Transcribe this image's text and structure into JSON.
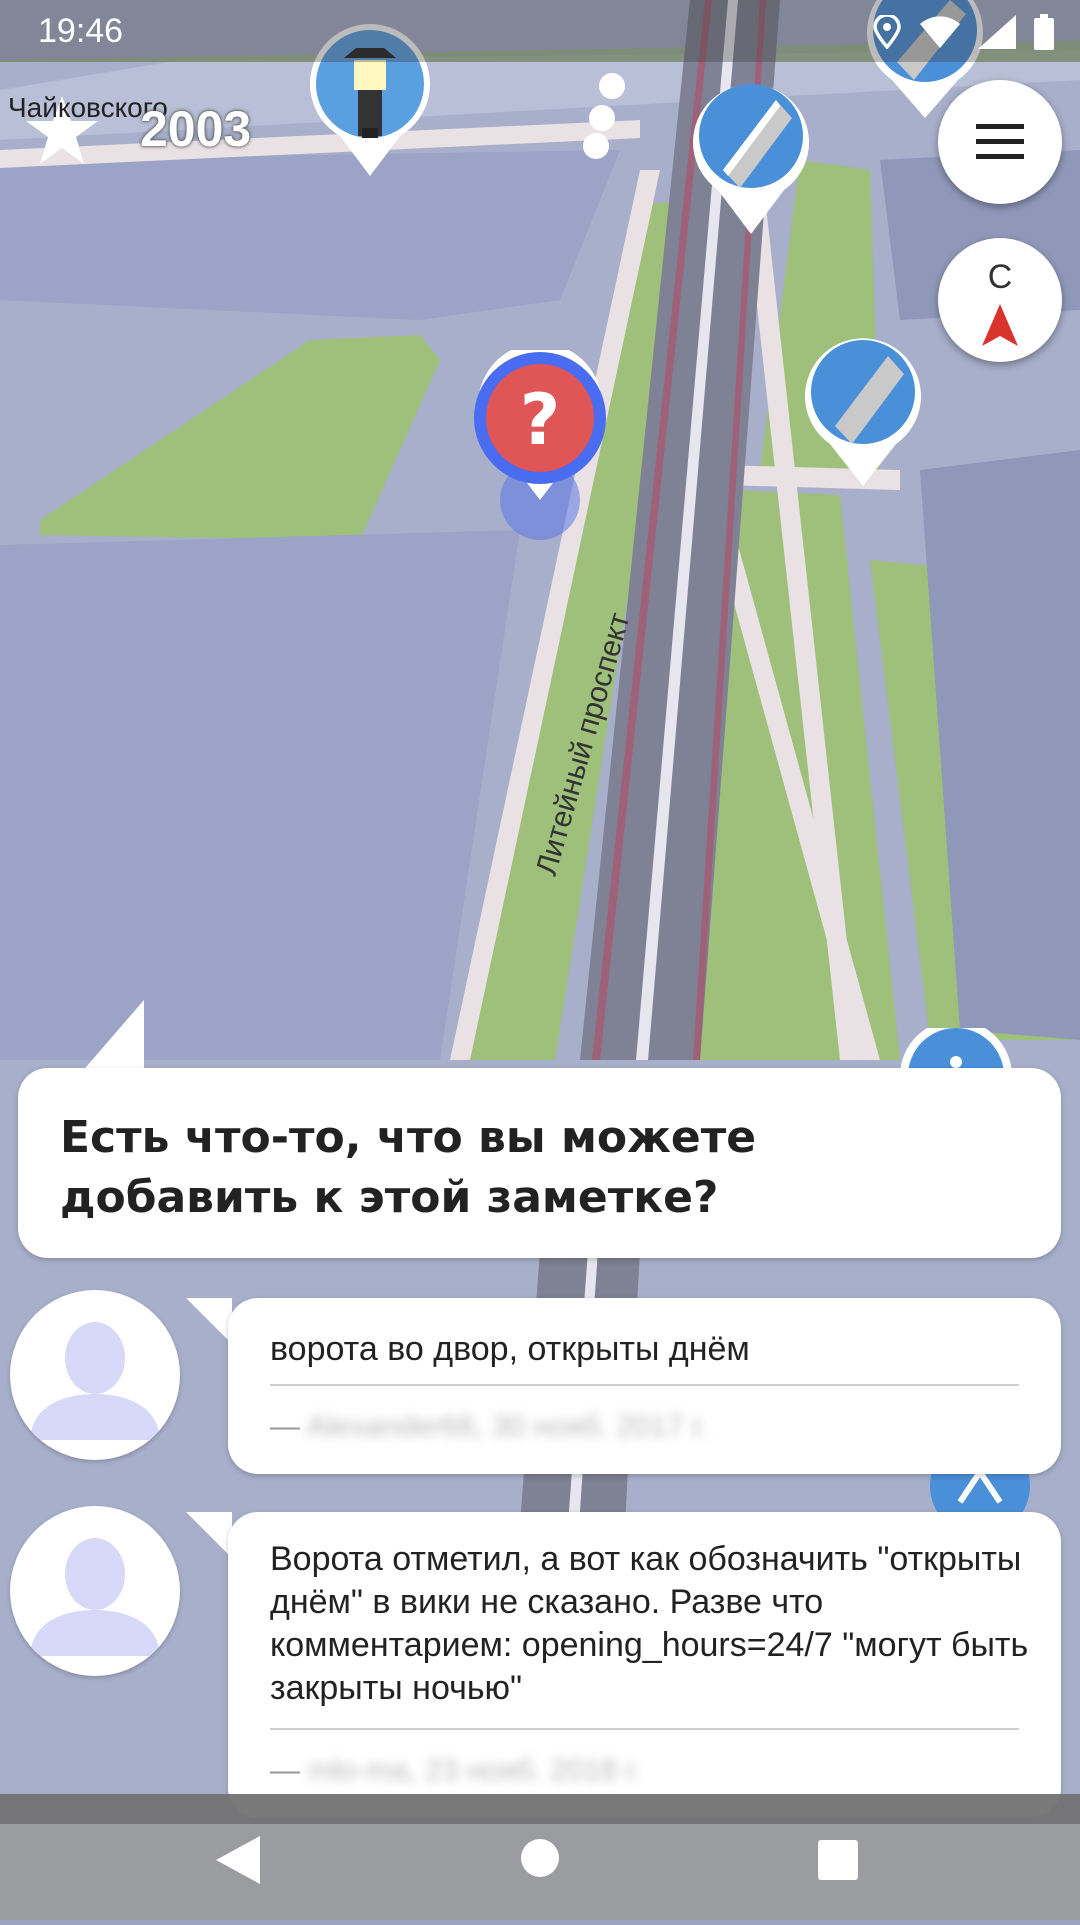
{
  "status_bar": {
    "time": "19:46"
  },
  "score": {
    "street_label": "Чайковского",
    "points": "2003"
  },
  "compass": {
    "letter": "С"
  },
  "map": {
    "street_name": "Литейный проспект"
  },
  "quest": {
    "question": "Есть что-то, что вы можете добавить к этой заметке?"
  },
  "comments": [
    {
      "text": "ворота во двор,  открыты днём",
      "author": "Alexander66, 30 нояб. 2017 г."
    },
    {
      "text": "Ворота отметил, а вот как обозначить \"открыты днём\" в вики не сказано. Разве что комментарием:  opening_hours=24/7 \"могут быть закрыты ночью\"",
      "author": "mlo-ma, 23 нояб. 2018 г."
    }
  ],
  "colors": {
    "accent_blue": "#4a6cf0",
    "marker_red": "#e05555",
    "lawn_green": "#9ec07a",
    "building_blue": "#9aa4c4"
  }
}
